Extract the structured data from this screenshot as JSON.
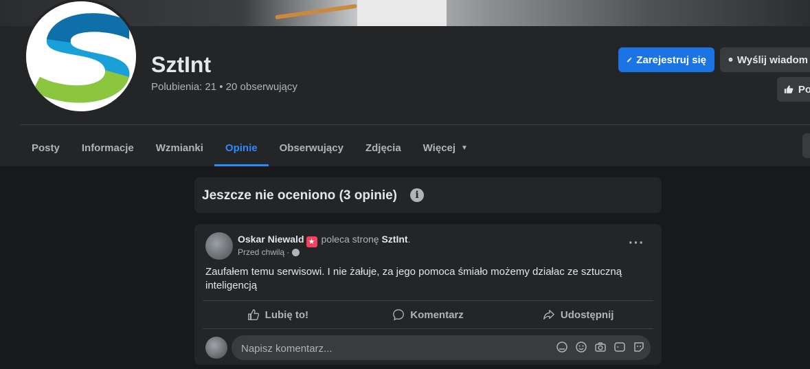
{
  "page": {
    "name": "SztInt",
    "stats": "Polubienia: 21 • 20 obserwujący"
  },
  "buttons": {
    "register": "Zarejestruj się",
    "message": "Wyślij wiadom",
    "like": "Po"
  },
  "tabs": [
    {
      "label": "Posty"
    },
    {
      "label": "Informacje"
    },
    {
      "label": "Wzmianki"
    },
    {
      "label": "Opinie",
      "active": true
    },
    {
      "label": "Obserwujący"
    },
    {
      "label": "Zdjęcia"
    },
    {
      "label": "Więcej"
    }
  ],
  "rating": {
    "title": "Jeszcze nie oceniono (3 opinie)"
  },
  "post": {
    "author": "Oskar Niewald",
    "action": "poleca stronę",
    "target": "SztInt",
    "time": "Przed chwilą ·",
    "body": "Zaufałem temu serwisowi. I nie żałuje, za jego pomoca śmiało możemy działac ze sztuczną inteligencją",
    "like_label": "Lubię to!",
    "comment_label": "Komentarz",
    "share_label": "Udostępnij"
  },
  "comment": {
    "placeholder": "Napisz komentarz..."
  },
  "colors": {
    "accent": "#1b74e4",
    "active_tab": "#2d88ff",
    "background": "#18191a",
    "card": "#242526"
  }
}
